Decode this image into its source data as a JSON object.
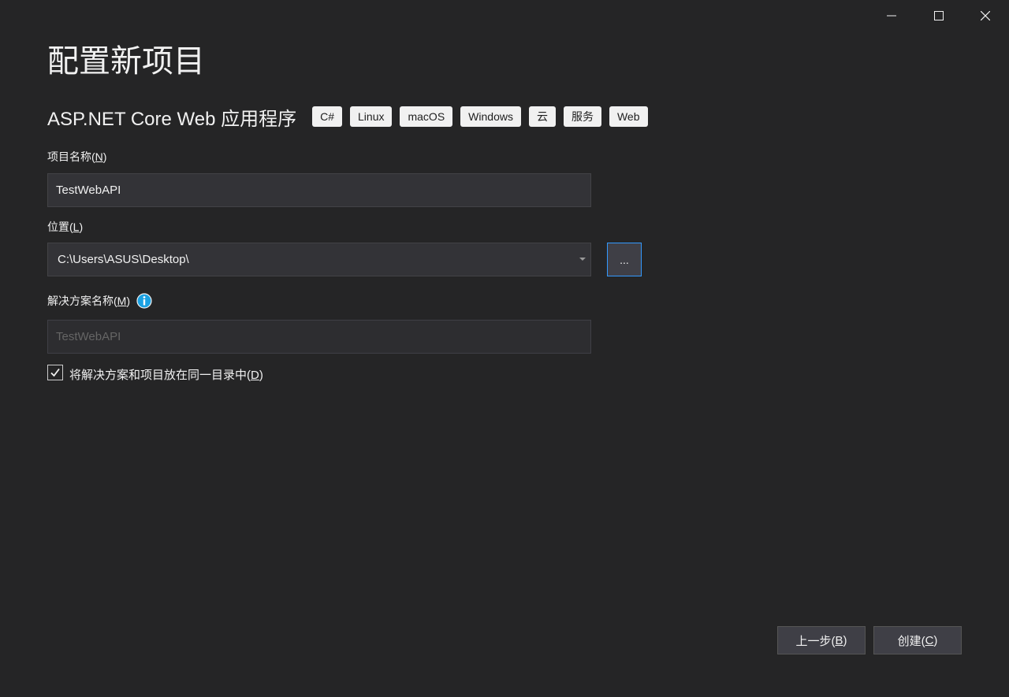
{
  "window": {
    "controls": {
      "minimize": "minimize-icon",
      "maximize": "maximize-icon",
      "close": "close-icon"
    }
  },
  "header": {
    "title": "配置新项目",
    "template_name": "ASP.NET Core Web 应用程序",
    "tags": [
      "C#",
      "Linux",
      "macOS",
      "Windows",
      "云",
      "服务",
      "Web"
    ]
  },
  "form": {
    "project_name": {
      "label_text": "项目名称(",
      "label_key": "N",
      "label_end": ")",
      "value": "TestWebAPI"
    },
    "location": {
      "label_text": "位置(",
      "label_key": "L",
      "label_end": ")",
      "value": "C:\\Users\\ASUS\\Desktop\\",
      "browse_label": "..."
    },
    "solution_name": {
      "label_text": "解决方案名称(",
      "label_key": "M",
      "label_end": ")",
      "value": "TestWebAPI",
      "info_icon": "info-icon"
    },
    "same_directory": {
      "checked": true,
      "label_text": "将解决方案和项目放在同一目录中(",
      "label_key": "D",
      "label_end": ")"
    }
  },
  "footer": {
    "back_text": "上一步(",
    "back_key": "B",
    "back_end": ")",
    "create_text": "创建(",
    "create_key": "C",
    "create_end": ")"
  },
  "colors": {
    "background": "#252526",
    "field_bg": "#333337",
    "accent_border": "#3399ff",
    "info_blue": "#1ba1e2"
  }
}
